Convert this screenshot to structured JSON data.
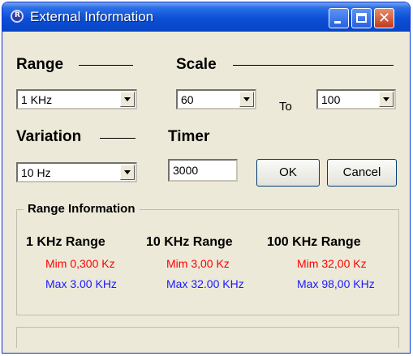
{
  "window": {
    "title": "External Information"
  },
  "range": {
    "label": "Range",
    "selected": "1 KHz"
  },
  "scale": {
    "label": "Scale",
    "from": "60",
    "to_label": "To",
    "to": "100"
  },
  "variation": {
    "label": "Variation",
    "selected": "10 Hz"
  },
  "timer": {
    "label": "Timer",
    "value": "3000"
  },
  "buttons": {
    "ok": "OK",
    "cancel": "Cancel"
  },
  "range_info": {
    "title": "Range Information",
    "columns": [
      {
        "heading": "1 KHz Range",
        "min": "Mim 0,300 Kz",
        "max": "Max 3.00 KHz"
      },
      {
        "heading": "10 KHz Range",
        "min": "Mim 3,00 Kz",
        "max": "Max 32.00 KHz"
      },
      {
        "heading": "100 KHz Range",
        "min": "Mim 32,00 Kz",
        "max": "Max 98,00 KHz"
      }
    ]
  },
  "colors": {
    "min_text": "#ff0000",
    "max_text": "#1a1aff",
    "titlebar": "#0b4fd6"
  }
}
